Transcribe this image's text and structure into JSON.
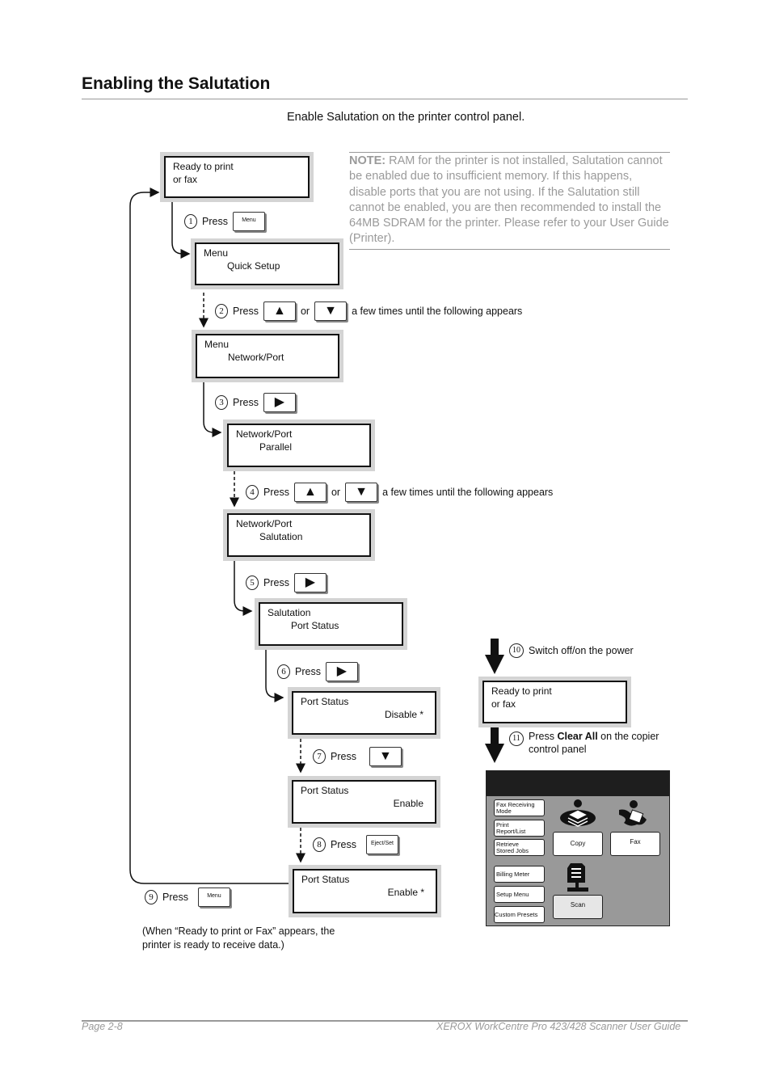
{
  "page": {
    "title": "Enabling the Salutation",
    "subtitle": "Enable Salutation on the printer control panel.",
    "note": {
      "label": "NOTE:",
      "text": " RAM for the printer is not installed, Salutation cannot be enabled due to insufficient memory. If this happens, disable ports that you are not using. If the Salutation still cannot be enabled, you are then recommended to install the 64MB SDRAM for the printer. Please refer to your User Guide (Printer)."
    },
    "colors": {
      "text": "#111111",
      "note": "#9a9a9a",
      "lcd_frame": "#d4d4d4",
      "panel_bg": "#999999",
      "panel_header": "#1e1e1e"
    }
  },
  "screens": {
    "ready": {
      "line1": "Ready to print",
      "line2": "or fax"
    },
    "menu_quick": {
      "line1": "Menu",
      "line2": "Quick Setup"
    },
    "menu_network": {
      "line1": "Menu",
      "line2": "Network/Port"
    },
    "network_parallel": {
      "line1": "Network/Port",
      "line2": "Parallel"
    },
    "network_salutation": {
      "line1": "Network/Port",
      "line2": "Salutation"
    },
    "salutation_port": {
      "line1": "Salutation",
      "line2": "Port Status"
    },
    "port_disable": {
      "line1": "Port Status",
      "line2": "Disable *"
    },
    "port_enable": {
      "line1": "Port Status",
      "line2": "Enable"
    },
    "port_enable_set": {
      "line1": "Port Status",
      "line2": "Enable *"
    },
    "ready2": {
      "line1": "Ready to print",
      "line2": "or fax"
    }
  },
  "steps": {
    "s1": {
      "num": "1",
      "press": "Press",
      "key": "Menu"
    },
    "s2": {
      "num": "2",
      "press": "Press",
      "key_up": "▲",
      "or": "or",
      "key_down": "▼",
      "hint": "a few times until the following appears"
    },
    "s3": {
      "num": "3",
      "press": "Press",
      "key": "▶"
    },
    "s4": {
      "num": "4",
      "press": "Press",
      "key_up": "▲",
      "or": "or",
      "key_down": "▼",
      "hint": "a few times until the following appears"
    },
    "s5": {
      "num": "5",
      "press": "Press",
      "key": "▶"
    },
    "s6": {
      "num": "6",
      "press": "Press",
      "key": "▶"
    },
    "s7": {
      "num": "7",
      "press": "Press",
      "key": "▼"
    },
    "s8": {
      "num": "8",
      "press": "Press",
      "key": "Eject/Set"
    },
    "s9": {
      "num": "9",
      "press": "Press",
      "key": "Menu"
    },
    "s10": {
      "num": "10",
      "text": "Switch off/on the power"
    },
    "s11": {
      "num": "11",
      "text_pre": "Press ",
      "text_bold": "Clear All",
      "text_post": " on the copier",
      "text_line2": "control panel"
    }
  },
  "ready_note": {
    "line1": "(When “Ready to print or Fax” appears, the",
    "line2": "printer is ready to receive data.)"
  },
  "control_panel": {
    "left_buttons": [
      {
        "line1": "Fax Receiving",
        "line2": "Mode"
      },
      {
        "line1": "Print",
        "line2": "Report/List"
      },
      {
        "line1": "Retrieve",
        "line2": "Stored Jobs"
      },
      {
        "line1": "Billing Meter",
        "line2": ""
      },
      {
        "line1": "Setup Menu",
        "line2": ""
      },
      {
        "line1": "Custom Presets",
        "line2": ""
      }
    ],
    "copy": "Copy",
    "fax": "Fax",
    "scan": "Scan"
  },
  "footer": {
    "left": "Page 2-8",
    "right": "XEROX WorkCentre Pro 423/428 Scanner User Guide"
  }
}
